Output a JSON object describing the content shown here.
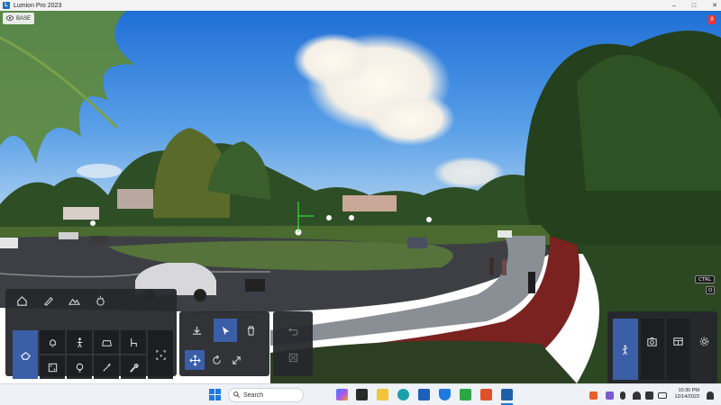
{
  "window": {
    "title": "Lumion Pro 2023",
    "minimize": "–",
    "maximize": "□",
    "close": "✕"
  },
  "viewport": {
    "mode_label": "BASE",
    "corner_badge": "8",
    "ctrl_key": "CTRL",
    "o_key": "O"
  },
  "tool_panel": {
    "categories": [
      "home-icon",
      "brush-icon",
      "terrain-icon",
      "effects-icon"
    ],
    "object_types": [
      "building-icon",
      "bell-icon",
      "person-icon",
      "car-icon",
      "chair-icon",
      "dice-icon",
      "bulb-icon",
      "magic-icon",
      "wrench-icon",
      "select-box-icon"
    ]
  },
  "edit_panel": {
    "tools": [
      "place-icon",
      "select-arrow-icon",
      "delete-icon",
      "move-icon",
      "rotate-icon",
      "scale-icon",
      "undo-icon",
      "grid-icon"
    ]
  },
  "right_panel": {
    "tools": [
      "camera-icon",
      "panorama-icon",
      "settings-icon"
    ]
  },
  "taskbar": {
    "search_placeholder": "Search",
    "time": "10:30 PM",
    "date": "12/14/2023",
    "accent": "#3b5ea8"
  }
}
